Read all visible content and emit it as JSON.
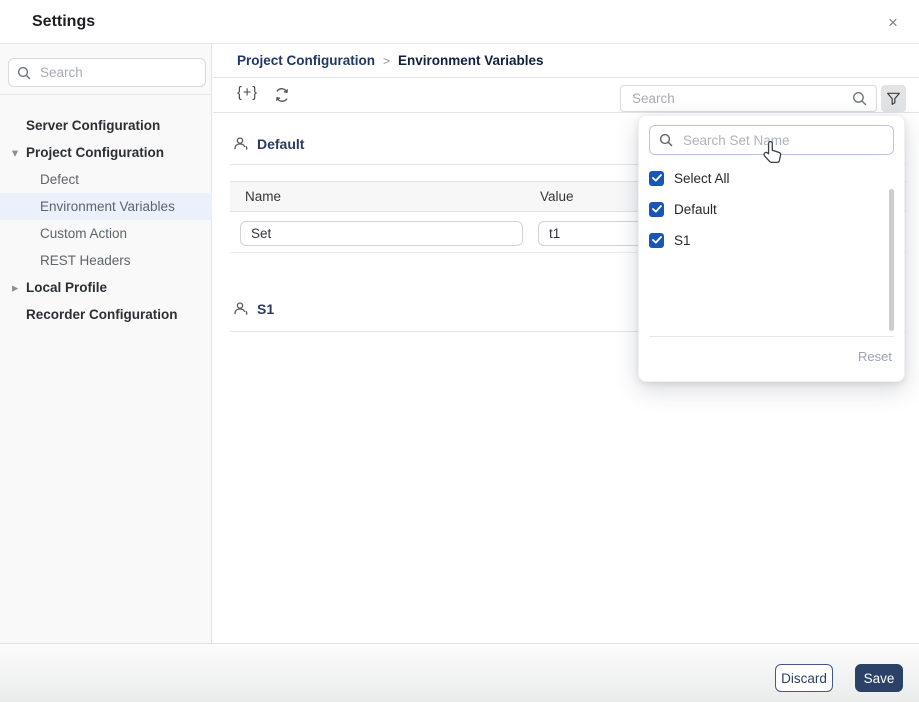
{
  "dialog": {
    "title": "Settings",
    "close_icon": "×"
  },
  "sidebar": {
    "search": {
      "placeholder": "Search"
    },
    "items": [
      {
        "label": "Server Configuration",
        "level": 0
      },
      {
        "label": "Project Configuration",
        "level": 0,
        "caret": "expanded"
      },
      {
        "label": "Defect",
        "level": 1
      },
      {
        "label": "Environment Variables",
        "level": 1,
        "selected": true
      },
      {
        "label": "Custom Action",
        "level": 1
      },
      {
        "label": "REST Headers",
        "level": 1
      },
      {
        "label": "Local Profile",
        "level": 0,
        "caret": "collapsed"
      },
      {
        "label": "Recorder Configuration",
        "level": 0
      }
    ]
  },
  "breadcrumb": {
    "parent": "Project Configuration",
    "separator": ">",
    "current": "Environment Variables"
  },
  "toolbar": {
    "add_label": "{+}",
    "refresh_icon": "refresh-icon",
    "search_placeholder": "Search",
    "filter_icon": "funnel-icon"
  },
  "content": {
    "sections": [
      {
        "name": "Default",
        "icon": "user-set-icon"
      },
      {
        "name": "S1",
        "icon": "user-set-icon"
      }
    ],
    "table": {
      "columns": [
        "Name",
        "Value"
      ],
      "rows": [
        {
          "name": "Set",
          "value": "t1"
        }
      ]
    }
  },
  "filter_popup": {
    "search_placeholder": "Search Set Name",
    "options": [
      {
        "label": "Select All",
        "checked": true
      },
      {
        "label": "Default",
        "checked": true
      },
      {
        "label": "S1",
        "checked": true
      }
    ],
    "reset_label": "Reset"
  },
  "footer": {
    "discard_label": "Discard",
    "save_label": "Save"
  },
  "colors": {
    "checkbox_blue": "#1857b5",
    "save_navy": "#2b4167",
    "breadcrumb_navy": "#1f3864",
    "selected_item_bg": "#eaf1fa"
  }
}
